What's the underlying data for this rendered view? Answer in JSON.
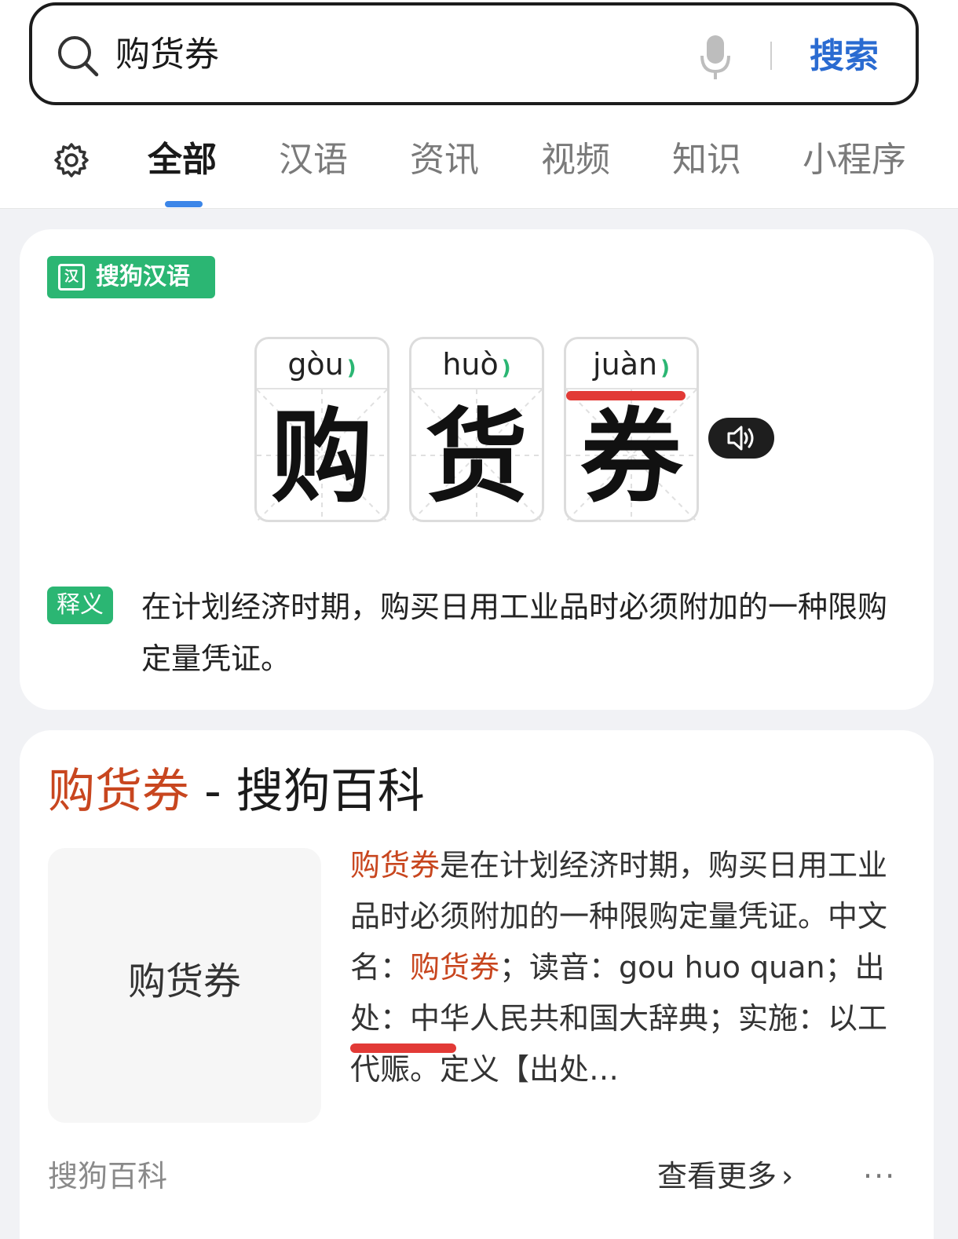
{
  "search": {
    "query": "购货券",
    "submit_label": "搜索"
  },
  "tabs": {
    "items": [
      {
        "label": "全部",
        "active": true
      },
      {
        "label": "汉语"
      },
      {
        "label": "资讯"
      },
      {
        "label": "视频"
      },
      {
        "label": "知识"
      },
      {
        "label": "小程序"
      }
    ]
  },
  "dict_card": {
    "brand_logo_char": "汉",
    "brand_label": "搜狗汉语",
    "characters": [
      {
        "char": "购",
        "pinyin": "gòu"
      },
      {
        "char": "货",
        "pinyin": "huò"
      },
      {
        "char": "券",
        "pinyin": "juàn"
      }
    ],
    "definition_tag": "释义",
    "definition_text": "在计划经济时期，购买日用工业品时必须附加的一种限购定量凭证。"
  },
  "baike_card": {
    "title_highlight": "购货券",
    "title_rest": " - 搜狗百科",
    "thumbnail_text": "购货券",
    "abstract_parts": [
      {
        "text": "购货券",
        "hl": true
      },
      {
        "text": "是在计划经济时期，购买日用工业品时必须附加的一种限购定量凭证。中文名："
      },
      {
        "text": "购货券",
        "hl": true
      },
      {
        "text": "；读音：gou huo quan；出处：中华人民共和国大辞典；实施：以工代赈。定义【出处…"
      }
    ],
    "source_label": "搜狗百科",
    "more_label": "查看更多",
    "more_chevron": "›",
    "menu_dots": "···"
  },
  "colors": {
    "brand_green": "#2bb673",
    "search_blue": "#2a6bd1",
    "highlight_red": "#c8461f",
    "annotation_red": "#e23a36"
  }
}
